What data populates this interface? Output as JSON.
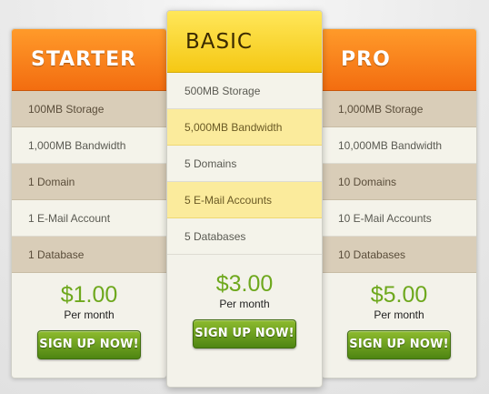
{
  "plans": [
    {
      "name": "STARTER",
      "features": [
        "100MB Storage",
        "1,000MB Bandwidth",
        "1 Domain",
        "1 E-Mail Account",
        "1 Database"
      ],
      "price": "$1.00",
      "period": "Per month",
      "cta": "SIGN UP NOW!"
    },
    {
      "name": "BASIC",
      "features": [
        "500MB Storage",
        "5,000MB Bandwidth",
        "5 Domains",
        "5 E-Mail Accounts",
        "5 Databases"
      ],
      "price": "$3.00",
      "period": "Per month",
      "cta": "SIGN UP NOW!"
    },
    {
      "name": "PRO",
      "features": [
        "1,000MB Storage",
        "10,000MB Bandwidth",
        "10 Domains",
        "10 E-Mail Accounts",
        "10 Databases"
      ],
      "price": "$5.00",
      "period": "Per month",
      "cta": "SIGN UP NOW!"
    }
  ],
  "colors": {
    "header_orange": "#f36d10",
    "header_yellow": "#f5c814",
    "price_green": "#6ea81d",
    "button_green": "#4e8512"
  }
}
